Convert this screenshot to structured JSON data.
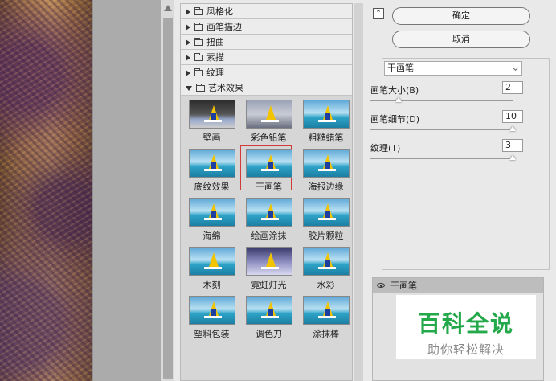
{
  "gallery": {
    "categories": [
      "风格化",
      "画笔描边",
      "扭曲",
      "素描",
      "纹理",
      "艺术效果"
    ],
    "thumbnails": [
      "壁画",
      "彩色铅笔",
      "粗糙蜡笔",
      "底纹效果",
      "干画笔",
      "海报边缘",
      "海绵",
      "绘画涂抹",
      "胶片颗粒",
      "木刻",
      "霓虹灯光",
      "水彩",
      "塑料包装",
      "调色刀",
      "涂抹棒"
    ],
    "selected": "干画笔"
  },
  "buttons": {
    "ok": "确定",
    "cancel": "取消"
  },
  "settings": {
    "filter": "干画笔",
    "params": [
      {
        "label": "画笔大小(B)",
        "value": "2",
        "level": 0.2
      },
      {
        "label": "画笔细节(D)",
        "value": "10",
        "level": 1.0
      },
      {
        "label": "纹理(T)",
        "value": "3",
        "level": 1.0
      }
    ]
  },
  "layers": {
    "item": "干画笔"
  },
  "watermark": {
    "title": "百科全说",
    "subtitle": "助你轻松解决"
  }
}
